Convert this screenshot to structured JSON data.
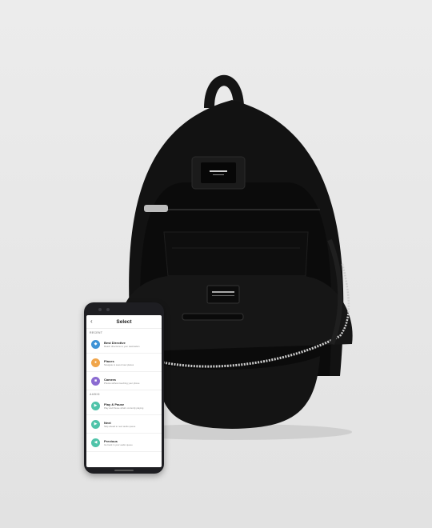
{
  "colors": {
    "background": "#e9e9e9",
    "bag": "#111111",
    "accent_blue": "#3f93d6",
    "accent_orange": "#f0a54a",
    "accent_purple": "#8b6bd1",
    "accent_teal": "#4fc3a9"
  },
  "header": {
    "back_icon": "chevron-left-icon",
    "title": "Select"
  },
  "sections": {
    "recent": "RECENT",
    "audio": "AUDIO"
  },
  "items": [
    {
      "title": "Best Directive",
      "subtitle": "Reach directions to your destination",
      "icon": "navigation-icon"
    },
    {
      "title": "Places",
      "subtitle": "Navigate to saved new places",
      "icon": "pin-icon"
    },
    {
      "title": "Camera",
      "subtitle": "Photos without touching your phone",
      "icon": "camera-icon"
    },
    {
      "title": "Play & Pause",
      "subtitle": "Play and Pause what's currently playing",
      "icon": "play-pause-icon"
    },
    {
      "title": "Next",
      "subtitle": "Skip ahead to next audio queue",
      "icon": "next-icon"
    },
    {
      "title": "Previous",
      "subtitle": "Go back in your audio queue",
      "icon": "previous-icon"
    }
  ]
}
